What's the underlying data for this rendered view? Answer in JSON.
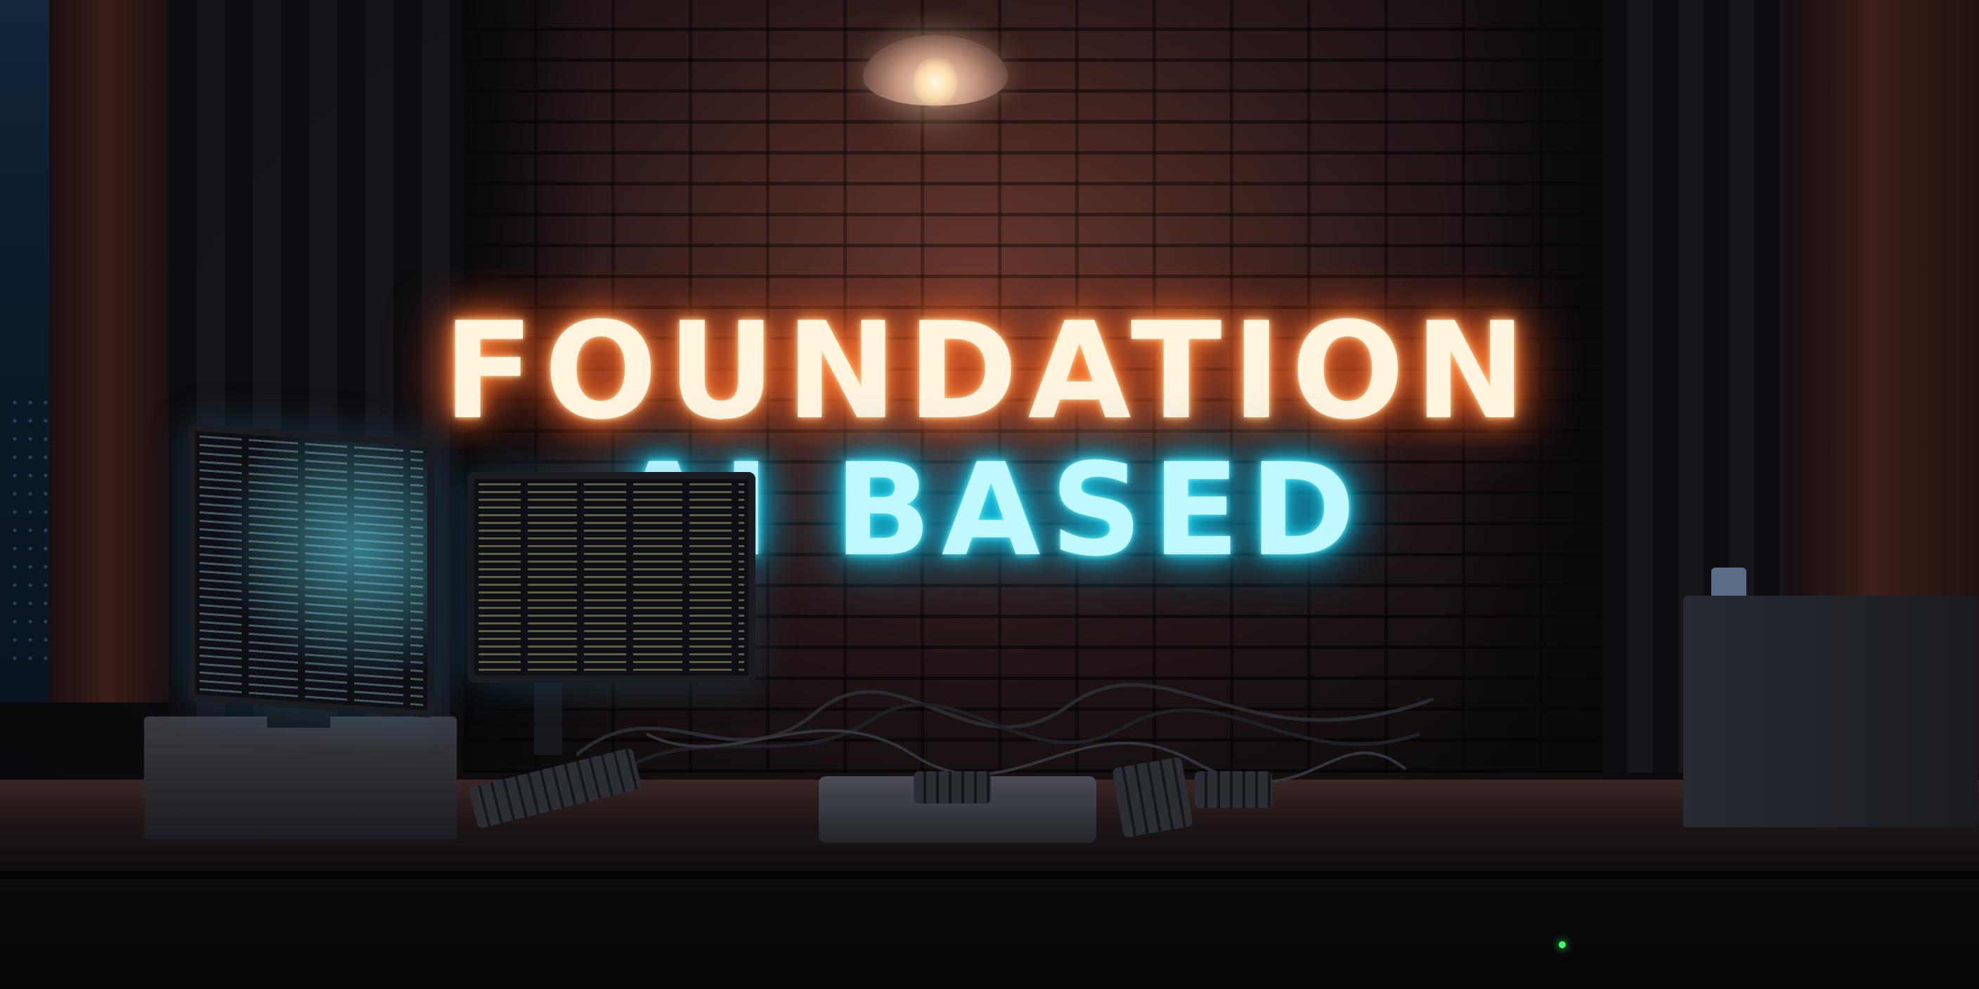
{
  "scene": {
    "neon_line_1": "FOUNDATION",
    "neon_line_2": "AI BASED",
    "colors": {
      "neon_warm": "#ff9a4a",
      "neon_cool": "#1fd6f0",
      "brick": "#3a201f",
      "status_led": "#3dff6a"
    }
  }
}
